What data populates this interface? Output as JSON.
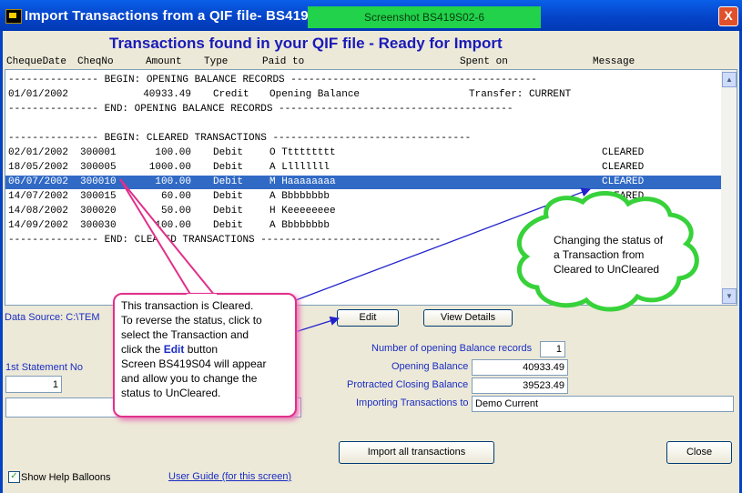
{
  "window": {
    "title": "Import Transactions from a QIF file- BS419S02",
    "screenshot_tag": "Screenshot BS419S02-6",
    "close_symbol": "X"
  },
  "heading": "Transactions found in your QIF file - Ready for Import",
  "columns": {
    "cheque_date": "ChequeDate",
    "cheque_no": "CheqNo",
    "amount": "Amount",
    "type": "Type",
    "paid_to": "Paid to",
    "spent_on": "Spent on",
    "message": "Message"
  },
  "rows": [
    {
      "text": "--------------- BEGIN: OPENING BALANCE RECORDS -----------------------------------------"
    },
    {
      "date": "01/01/2002",
      "no": "",
      "amount": "40933.49",
      "type": "Credit",
      "paid": "Opening Balance",
      "spent": "Transfer: CURRENT",
      "msg": ""
    },
    {
      "text": "--------------- END: OPENING BALANCE RECORDS ---------------------------------------"
    },
    {
      "text": ""
    },
    {
      "text": "--------------- BEGIN: CLEARED TRANSACTIONS ---------------------------------"
    },
    {
      "date": "02/01/2002",
      "no": "300001",
      "amount": "100.00",
      "type": "Debit",
      "paid": "O Ttttttttt",
      "spent": "",
      "msg": "CLEARED"
    },
    {
      "date": "18/05/2002",
      "no": "300005",
      "amount": "1000.00",
      "type": "Debit",
      "paid": "A Llllllll",
      "spent": "",
      "msg": "CLEARED"
    },
    {
      "date": "06/07/2002",
      "no": "300010",
      "amount": "100.00",
      "type": "Debit",
      "paid": "M Haaaaaaaa",
      "spent": "",
      "msg": "CLEARED",
      "selected": true
    },
    {
      "date": "14/07/2002",
      "no": "300015",
      "amount": "60.00",
      "type": "Debit",
      "paid": "A Bbbbbbbb",
      "spent": "",
      "msg": "CLEARED"
    },
    {
      "date": "14/08/2002",
      "no": "300020",
      "amount": "50.00",
      "type": "Debit",
      "paid": "H Keeeeeeee",
      "spent": "",
      "msg": "CLEARED"
    },
    {
      "date": "14/09/2002",
      "no": "300030",
      "amount": "100.00",
      "type": "Debit",
      "paid": "A Bbbbbbbb",
      "spent": "",
      "msg": "CLEARED"
    },
    {
      "text": "--------------- END: CLEARED TRANSACTIONS ------------------------------"
    }
  ],
  "data_source_label": "Data Source: C:\\TEM",
  "buttons": {
    "edit": "Edit",
    "view_details": "View Details",
    "import_all": "Import all transactions",
    "close": "Close"
  },
  "statement": {
    "label": "1st Statement No",
    "value": "1"
  },
  "summary": {
    "opening_records_label": "Number of opening Balance records",
    "opening_records_value": "1",
    "opening_balance_label": "Opening Balance",
    "opening_balance_value": "40933.49",
    "closing_balance_label": "Protracted Closing Balance",
    "closing_balance_value": "39523.49",
    "importing_to_label": "Importing Transactions to",
    "importing_to_value": "Demo Current"
  },
  "help_balloons": {
    "label": "Show Help Balloons",
    "checked": true
  },
  "user_guide_link": "User Guide (for this screen)",
  "balloon_pink": {
    "line1": "This transaction is Cleared.",
    "line2": "To reverse the status, click to",
    "line3": "select the Transaction and",
    "line4_pre": "click the ",
    "line4_edit": "Edit",
    "line4_post": " button",
    "line5": "Screen BS419S04 will appear",
    "line6": "and allow you to change the",
    "line7": "status to UnCleared."
  },
  "balloon_green": {
    "line1": "Changing the status of",
    "line2": "a Transaction from",
    "line3": "Cleared to UnCleared"
  },
  "colors": {
    "accent": "#1a2cc4",
    "selection": "#316ac5",
    "titlebar": "#0442c6",
    "tag": "#22d24a"
  }
}
